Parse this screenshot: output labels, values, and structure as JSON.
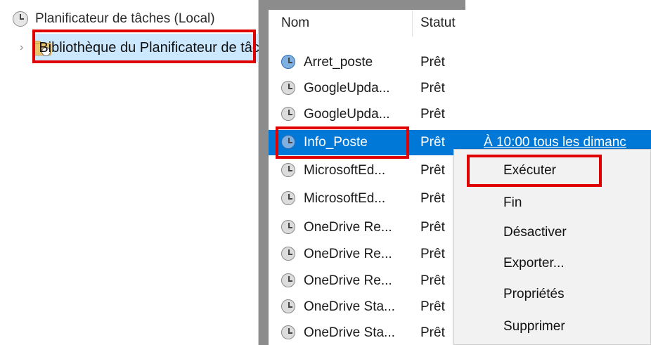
{
  "tree": {
    "root_label": "Planificateur de tâches (Local)",
    "child_label": "Bibliothèque du Planificateur de tâches"
  },
  "list": {
    "headers": {
      "name": "Nom",
      "status": "Statut"
    },
    "rows": [
      {
        "name": "Arret_poste",
        "status": "Prêt",
        "trigger": ""
      },
      {
        "name": "GoogleUpda...",
        "status": "Prêt",
        "trigger": ""
      },
      {
        "name": "GoogleUpda...",
        "status": "Prêt",
        "trigger": ""
      },
      {
        "name": "Info_Poste",
        "status": "Prêt",
        "trigger": "À 10:00 tous les dimanc",
        "selected": true
      },
      {
        "name": "MicrosoftEd...",
        "status": "Prêt",
        "trigger": ""
      },
      {
        "name": "MicrosoftEd...",
        "status": "Prêt",
        "trigger": ""
      },
      {
        "name": "OneDrive Re...",
        "status": "Prêt",
        "trigger": ""
      },
      {
        "name": "OneDrive Re...",
        "status": "Prêt",
        "trigger": ""
      },
      {
        "name": "OneDrive Re...",
        "status": "Prêt",
        "trigger": ""
      },
      {
        "name": "OneDrive Sta...",
        "status": "Prêt",
        "trigger": ""
      },
      {
        "name": "OneDrive Sta...",
        "status": "Prêt",
        "trigger": ""
      }
    ]
  },
  "context_menu": {
    "items": [
      "Exécuter",
      "Fin",
      "Désactiver",
      "Exporter...",
      "Propriétés",
      "Supprimer"
    ]
  },
  "icons": {
    "root": "task-scheduler-clock-icon",
    "folder": "folder-clock-icon",
    "task": "task-clock-icon",
    "expand": "chevron-right-icon"
  },
  "colors": {
    "selection": "#0078d7",
    "tree_selection": "#cce8ff",
    "highlight_box": "#e00000",
    "menu_bg": "#f2f2f2",
    "splitter": "#8c8c8c"
  }
}
